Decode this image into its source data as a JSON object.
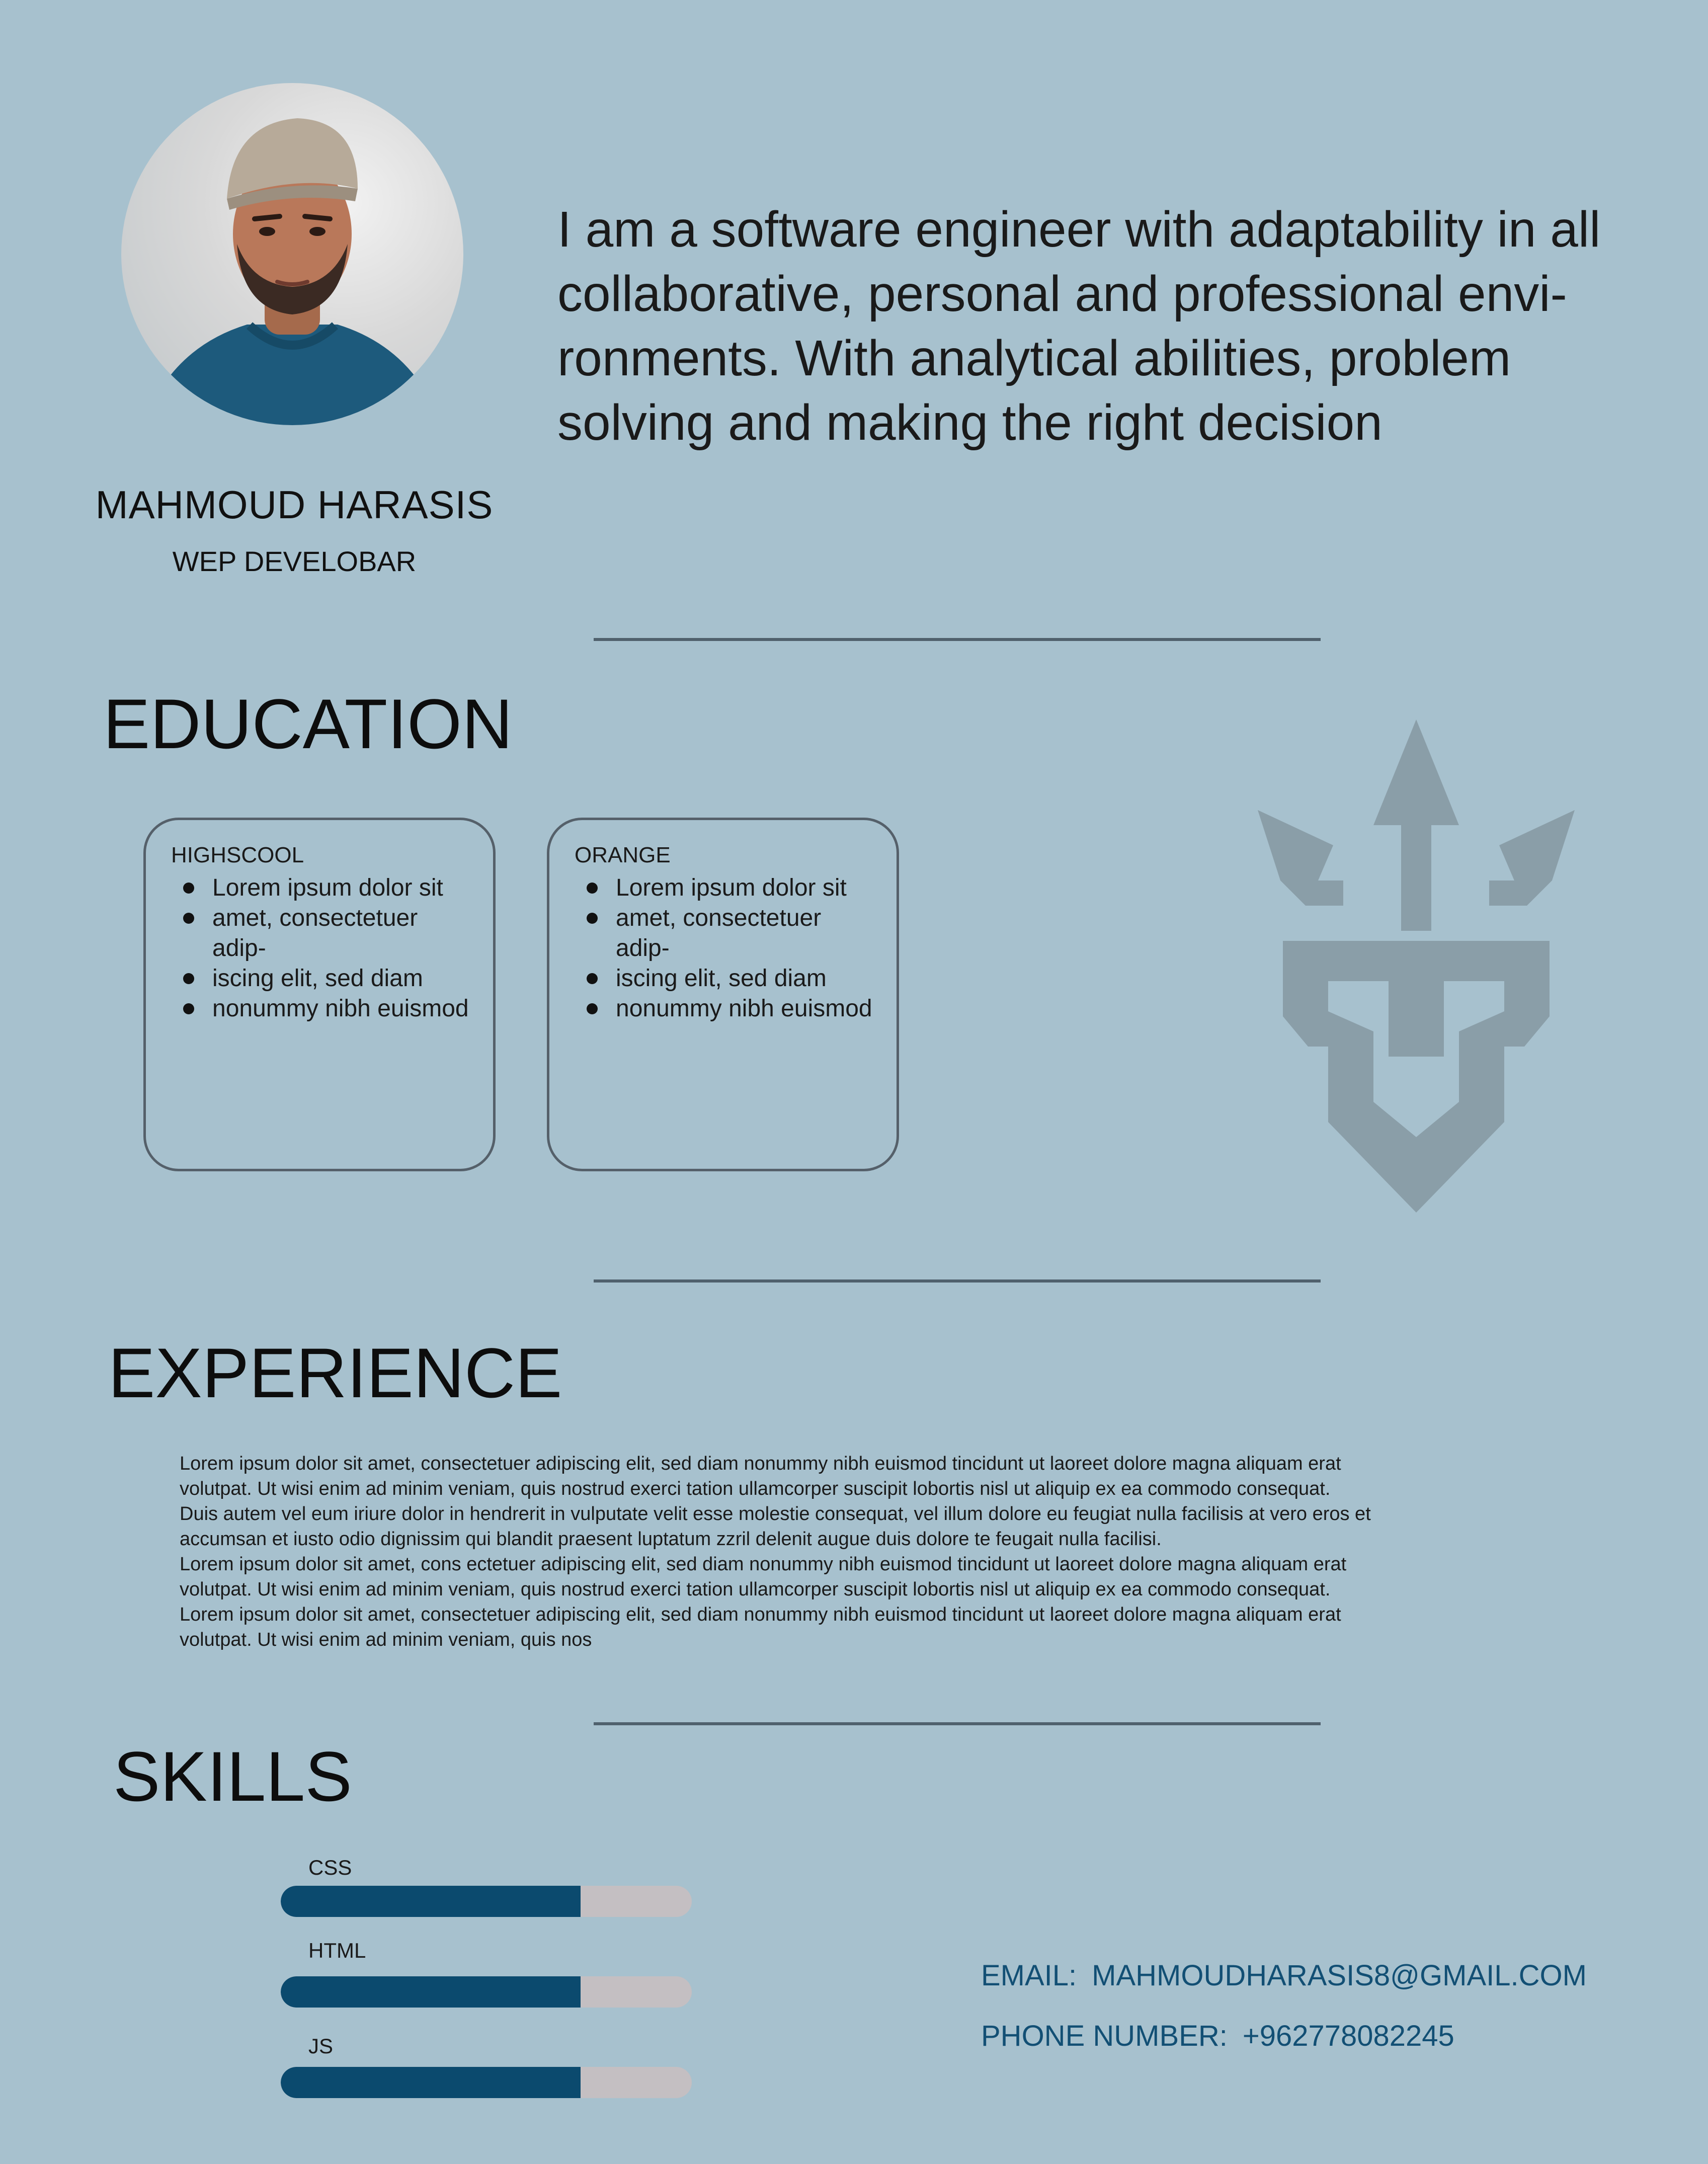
{
  "profile": {
    "intro": "I am a software engineer with adaptability in all collaborative, personal and professional envi-ronments. With analytical abilities, problem solving and making the right decision",
    "name": "MAHMOUD HARASIS",
    "role": "WEP DEVELOBAR"
  },
  "sections": {
    "education": "EDUCATION",
    "experience": "EXPERIENCE",
    "skills": "SKILLS"
  },
  "education": [
    {
      "title": "HIGHSCOOL",
      "items": [
        "Lorem ipsum dolor sit",
        "amet, consectetuer adip-",
        "iscing elit, sed diam",
        "nonummy nibh euismod"
      ]
    },
    {
      "title": "ORANGE",
      "items": [
        "Lorem ipsum dolor sit",
        "amet, consectetuer adip-",
        "iscing elit, sed diam",
        "nonummy nibh euismod"
      ]
    }
  ],
  "experience": {
    "lines": [
      "Lorem ipsum dolor sit amet, consectetuer adipiscing elit, sed diam nonummy nibh euismod tincidunt ut laoreet dolore magna aliquam erat",
      "volutpat. Ut wisi enim ad minim veniam, quis nostrud exerci tation ullamcorper suscipit lobortis nisl ut aliquip ex ea commodo consequat.",
      "Duis autem vel eum iriure dolor in hendrerit in vulputate velit esse molestie consequat, vel illum dolore eu feugiat nulla facilisis at vero eros et",
      "accumsan et iusto odio dignissim qui blandit praesent luptatum zzril delenit augue duis dolore te feugait nulla facilisi.",
      "Lorem ipsum dolor sit amet, cons ectetuer adipiscing elit, sed diam nonummy nibh euismod tincidunt ut laoreet dolore magna aliquam erat",
      "volutpat. Ut wisi enim ad minim veniam, quis nostrud exerci tation ullamcorper suscipit lobortis nisl ut aliquip ex ea commodo consequat.",
      "Lorem ipsum dolor sit amet, consectetuer adipiscing elit, sed diam nonummy nibh euismod tincidunt ut laoreet dolore magna aliquam erat",
      "volutpat. Ut wisi enim ad minim veniam, quis nos"
    ]
  },
  "skills": [
    {
      "label": "CSS",
      "level": 0.73
    },
    {
      "label": "HTML",
      "level": 0.73
    },
    {
      "label": "JS",
      "level": 0.73
    }
  ],
  "contact": {
    "email_label": "EMAIL:",
    "email": "MAHMOUDHARASIS8@GMAIL.COM",
    "phone_label": "PHONE NUMBER:",
    "phone": "+962778082245"
  },
  "colors": {
    "background": "#a7c1ce",
    "accent": "#0b4a6e",
    "bar_track": "#c4bfc2",
    "contact_text": "#124f74",
    "logo": "#8a9ea8"
  },
  "icons": {
    "logo": "trident-crown-monogram-icon"
  }
}
